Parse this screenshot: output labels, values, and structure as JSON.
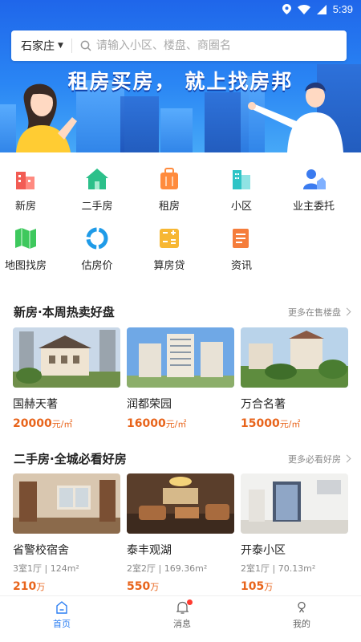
{
  "status": {
    "time": "5:39"
  },
  "search": {
    "city": "石家庄",
    "placeholder": "请输入小区、楼盘、商圈名"
  },
  "banner": {
    "slogan": "租房买房， 就上找房邦"
  },
  "categories": [
    {
      "label": "新房",
      "icon": "new-house-icon",
      "color": "#f25c54"
    },
    {
      "label": "二手房",
      "icon": "second-hand-icon",
      "color": "#2cc08a"
    },
    {
      "label": "租房",
      "icon": "rent-icon",
      "color": "#ff8b3d"
    },
    {
      "label": "小区",
      "icon": "community-icon",
      "color": "#2fc4c6"
    },
    {
      "label": "业主委托",
      "icon": "owner-icon",
      "color": "#3b7bef"
    },
    {
      "label": "地图找房",
      "icon": "map-icon",
      "color": "#3ec85d"
    },
    {
      "label": "估房价",
      "icon": "valuation-icon",
      "color": "#1f9be8"
    },
    {
      "label": "算房贷",
      "icon": "calculator-icon",
      "color": "#f7b733"
    },
    {
      "label": "资讯",
      "icon": "news-icon",
      "color": "#f57d3b"
    }
  ],
  "new_homes": {
    "title": "新房·本周热卖好盘",
    "more": "更多在售楼盘",
    "items": [
      {
        "name": "国赫天著",
        "price": "20000",
        "unit": "元/㎡"
      },
      {
        "name": "润都荣园",
        "price": "16000",
        "unit": "元/㎡"
      },
      {
        "name": "万合名著",
        "price": "15000",
        "unit": "元/㎡"
      }
    ]
  },
  "second_hand": {
    "title": "二手房·全城必看好房",
    "more": "更多必看好房",
    "items": [
      {
        "name": "省警校宿舍",
        "meta": "3室1厅 | 124m²",
        "price": "210",
        "unit": "万"
      },
      {
        "name": "泰丰观湖",
        "meta": "2室2厅 | 169.36m²",
        "price": "550",
        "unit": "万"
      },
      {
        "name": "开泰小区",
        "meta": "2室1厅 | 70.13m²",
        "price": "105",
        "unit": "万"
      }
    ]
  },
  "tabbar": [
    {
      "label": "首页",
      "icon": "home-icon"
    },
    {
      "label": "消息",
      "icon": "bell-icon"
    },
    {
      "label": "我的",
      "icon": "profile-icon"
    }
  ],
  "colors": {
    "accent": "#2b7ef2",
    "price": "#e8641b",
    "badge": "#ff3b30"
  }
}
